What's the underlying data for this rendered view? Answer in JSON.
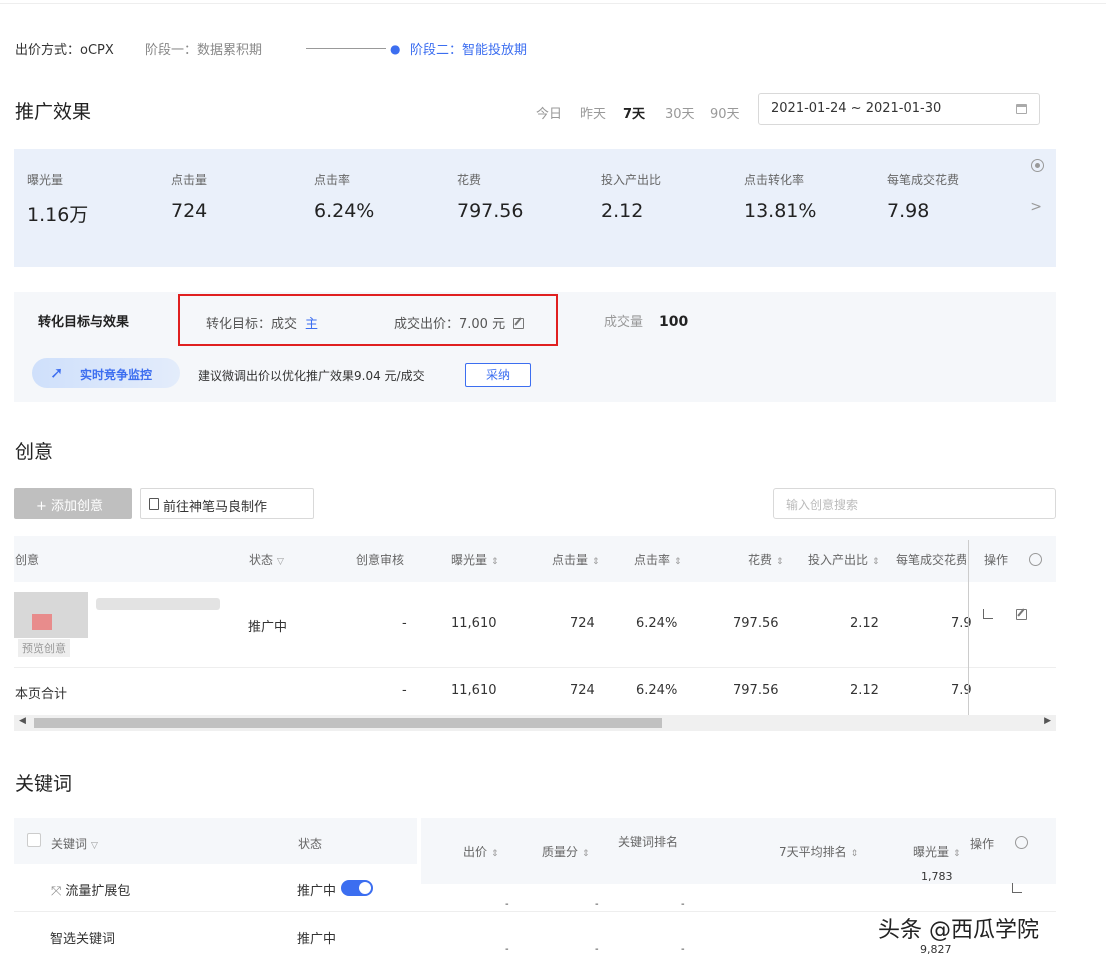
{
  "bid": {
    "method": "出价方式：oCPX",
    "stage1": "阶段一：数据累积期",
    "stage2": "阶段二：智能投放期"
  },
  "effect": {
    "title": "推广效果",
    "date_tabs": [
      "今日",
      "昨天",
      "7天",
      "30天",
      "90天"
    ],
    "active_tab": "7天",
    "date_range": "2021-01-24 ~ 2021-01-30",
    "metrics": [
      {
        "label": "曝光量",
        "value": "1.16万"
      },
      {
        "label": "点击量",
        "value": "724"
      },
      {
        "label": "点击率",
        "value": "6.24%"
      },
      {
        "label": "花费",
        "value": "797.56"
      },
      {
        "label": "投入产出比",
        "value": "2.12"
      },
      {
        "label": "点击转化率",
        "value": "13.81%"
      },
      {
        "label": "每笔成交花费",
        "value": "7.98"
      }
    ]
  },
  "conversion": {
    "title": "转化目标与效果",
    "target": "转化目标：成交",
    "main_tag": "主",
    "bid": "成交出价：7.00 元",
    "volume_label": "成交量",
    "volume_value": "100",
    "monitor_label": "实时竞争监控",
    "suggestion": "建议微调出价以优化推广效果9.04 元/成交",
    "adopt": "采纳"
  },
  "creative": {
    "title": "创意",
    "add_button": "+ 添加创意",
    "goto_button": "前往神笔马良制作",
    "search_placeholder": "输入创意搜索",
    "headers": [
      "创意",
      "状态",
      "创意审核",
      "曝光量",
      "点击量",
      "点击率",
      "花费",
      "投入产出比",
      "每笔成交花费",
      "操作"
    ],
    "row": {
      "thumb_label": "预览创意",
      "status": "推广中",
      "review": "-",
      "impressions": "11,610",
      "clicks": "724",
      "ctr": "6.24%",
      "cost": "797.56",
      "roi": "2.12",
      "cpa": "7.9"
    },
    "total": {
      "label": "本页合计",
      "review": "-",
      "impressions": "11,610",
      "clicks": "724",
      "ctr": "6.24%",
      "cost": "797.56",
      "roi": "2.12",
      "cpa": "7.9"
    }
  },
  "keywords": {
    "title": "关键词",
    "headers": [
      "关键词",
      "状态",
      "出价",
      "质量分",
      "关键词排名",
      "7天平均排名",
      "曝光量",
      "操作"
    ],
    "rows": [
      {
        "name": "流量扩展包",
        "status": "推广中",
        "impressions": "1,783"
      },
      {
        "name": "智选关键词",
        "status": "推广中",
        "impressions": "9,827"
      }
    ],
    "dash": "-"
  },
  "watermark": "头条 @西瓜学院"
}
